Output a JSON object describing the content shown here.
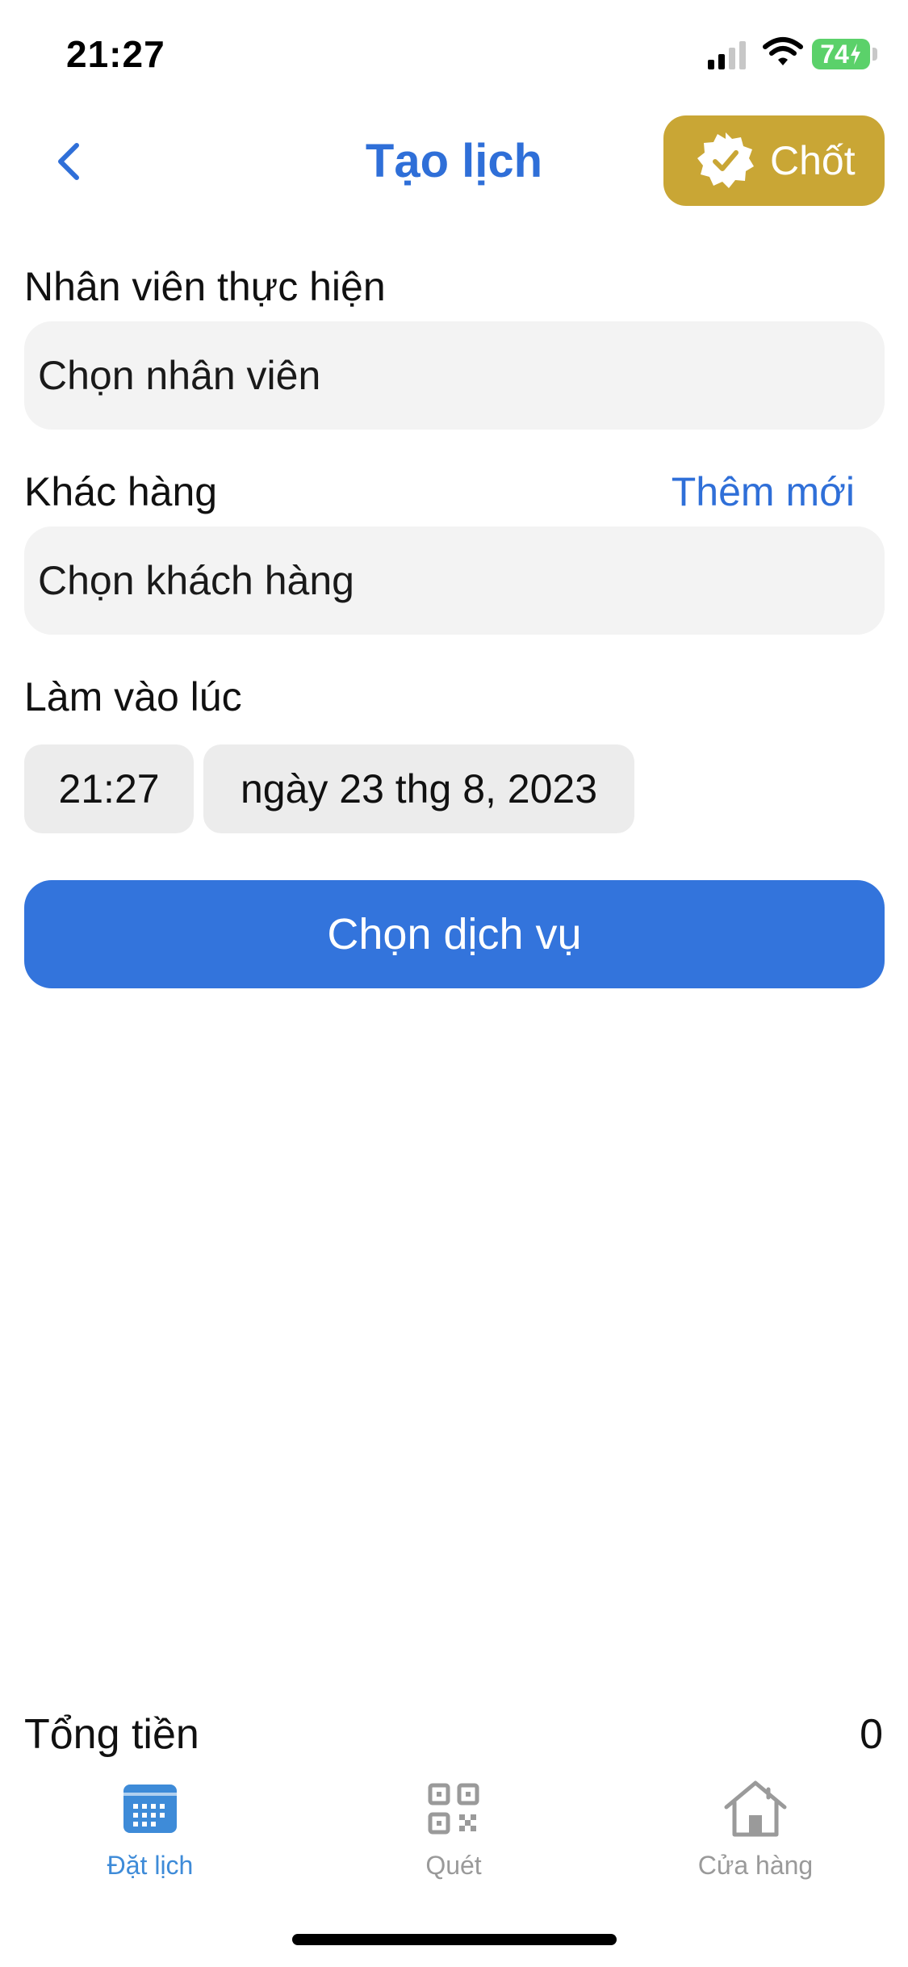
{
  "status_bar": {
    "time": "21:27",
    "battery": "74"
  },
  "nav": {
    "title": "Tạo lịch",
    "confirm_label": "Chốt"
  },
  "form": {
    "staff_label": "Nhân viên thực hiện",
    "staff_value": "Chọn nhân viên",
    "customer_label": "Khác hàng",
    "add_new": "Thêm mới",
    "customer_value": "Chọn khách hàng",
    "time_label": "Làm vào lúc",
    "time_value": "21:27",
    "date_value": "ngày 23 thg 8, 2023",
    "choose_service": "Chọn dịch vụ"
  },
  "total": {
    "label": "Tổng tiền",
    "value": "0"
  },
  "tabs": [
    {
      "label": "Đặt lịch",
      "icon": "calendar-icon",
      "active": true
    },
    {
      "label": "Quét",
      "icon": "qr-code-icon",
      "active": false
    },
    {
      "label": "Cửa hàng",
      "icon": "home-icon",
      "active": false
    }
  ],
  "colors": {
    "accent": "#3374dc",
    "gold": "#c9a635",
    "field_bg": "#f3f3f3",
    "battery": "#5bd16a"
  }
}
